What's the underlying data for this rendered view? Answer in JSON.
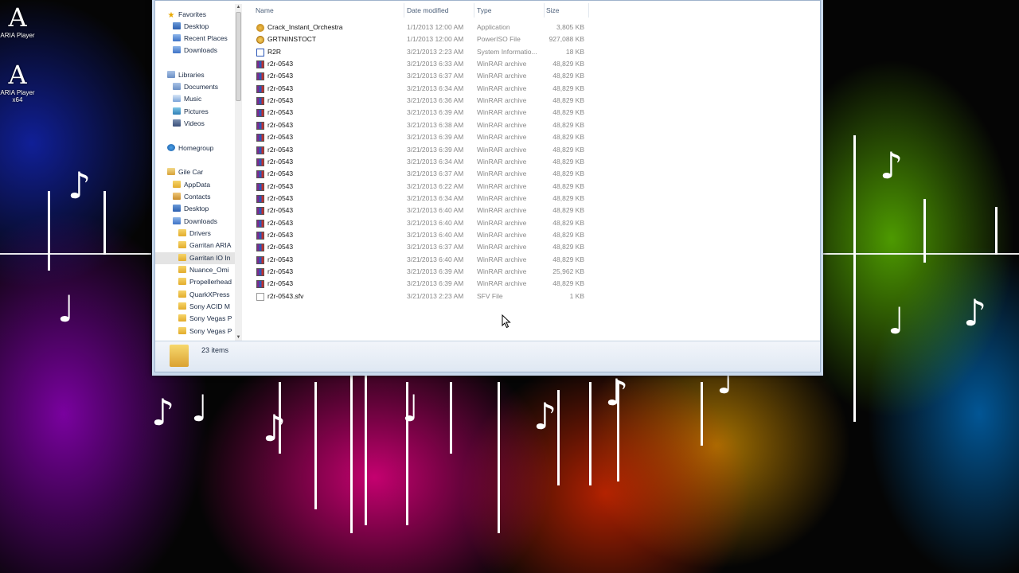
{
  "desktop": {
    "icons": [
      {
        "label": "ARIA Player",
        "glyph": "A"
      },
      {
        "label": "ARIA Player x64",
        "glyph": "A"
      }
    ],
    "deco_notes": [
      "♪",
      "♩",
      "♪",
      "♩",
      "♪",
      "♩",
      "♪"
    ]
  },
  "explorer": {
    "nav": {
      "favorites": "Favorites",
      "fav_items": [
        "Desktop",
        "Recent Places",
        "Downloads"
      ],
      "libraries": "Libraries",
      "lib_items": [
        "Documents",
        "Music",
        "Pictures",
        "Videos"
      ],
      "homegroup": "Homegroup",
      "user": "Gile Car",
      "user_items": [
        "AppData",
        "Contacts",
        "Desktop",
        "Downloads"
      ],
      "download_folders": [
        "Drivers",
        "Garritan ARIA",
        "Garritan IO In",
        "Nuance_Omi",
        "Propellerhead",
        "QuarkXPress",
        "Sony ACID M",
        "Sony Vegas P",
        "Sony Vegas P"
      ],
      "selected": "Garritan IO In"
    },
    "columns": {
      "name": "Name",
      "date": "Date modified",
      "type": "Type",
      "size": "Size"
    },
    "files": [
      {
        "icon": "app",
        "name": "Crack_Instant_Orchestra",
        "date": "1/1/2013 12:00 AM",
        "type": "Application",
        "size": "3,805 KB"
      },
      {
        "icon": "iso",
        "name": "GRTNINSTOCT",
        "date": "1/1/2013 12:00 AM",
        "type": "PowerISO File",
        "size": "927,088 KB"
      },
      {
        "icon": "info",
        "name": "R2R",
        "date": "3/21/2013 2:23 AM",
        "type": "System Informatio...",
        "size": "18 KB"
      },
      {
        "icon": "rar",
        "name": "r2r-0543",
        "date": "3/21/2013 6:33 AM",
        "type": "WinRAR archive",
        "size": "48,829 KB"
      },
      {
        "icon": "rar",
        "name": "r2r-0543",
        "date": "3/21/2013 6:37 AM",
        "type": "WinRAR archive",
        "size": "48,829 KB"
      },
      {
        "icon": "rar",
        "name": "r2r-0543",
        "date": "3/21/2013 6:34 AM",
        "type": "WinRAR archive",
        "size": "48,829 KB"
      },
      {
        "icon": "rar",
        "name": "r2r-0543",
        "date": "3/21/2013 6:36 AM",
        "type": "WinRAR archive",
        "size": "48,829 KB"
      },
      {
        "icon": "rar",
        "name": "r2r-0543",
        "date": "3/21/2013 6:39 AM",
        "type": "WinRAR archive",
        "size": "48,829 KB"
      },
      {
        "icon": "rar",
        "name": "r2r-0543",
        "date": "3/21/2013 6:38 AM",
        "type": "WinRAR archive",
        "size": "48,829 KB"
      },
      {
        "icon": "rar",
        "name": "r2r-0543",
        "date": "3/21/2013 6:39 AM",
        "type": "WinRAR archive",
        "size": "48,829 KB"
      },
      {
        "icon": "rar",
        "name": "r2r-0543",
        "date": "3/21/2013 6:39 AM",
        "type": "WinRAR archive",
        "size": "48,829 KB"
      },
      {
        "icon": "rar",
        "name": "r2r-0543",
        "date": "3/21/2013 6:34 AM",
        "type": "WinRAR archive",
        "size": "48,829 KB"
      },
      {
        "icon": "rar",
        "name": "r2r-0543",
        "date": "3/21/2013 6:37 AM",
        "type": "WinRAR archive",
        "size": "48,829 KB"
      },
      {
        "icon": "rar",
        "name": "r2r-0543",
        "date": "3/21/2013 6:22 AM",
        "type": "WinRAR archive",
        "size": "48,829 KB"
      },
      {
        "icon": "rar",
        "name": "r2r-0543",
        "date": "3/21/2013 6:34 AM",
        "type": "WinRAR archive",
        "size": "48,829 KB"
      },
      {
        "icon": "rar",
        "name": "r2r-0543",
        "date": "3/21/2013 6:40 AM",
        "type": "WinRAR archive",
        "size": "48,829 KB"
      },
      {
        "icon": "rar",
        "name": "r2r-0543",
        "date": "3/21/2013 6:40 AM",
        "type": "WinRAR archive",
        "size": "48,829 KB"
      },
      {
        "icon": "rar",
        "name": "r2r-0543",
        "date": "3/21/2013 6:40 AM",
        "type": "WinRAR archive",
        "size": "48,829 KB"
      },
      {
        "icon": "rar",
        "name": "r2r-0543",
        "date": "3/21/2013 6:37 AM",
        "type": "WinRAR archive",
        "size": "48,829 KB"
      },
      {
        "icon": "rar",
        "name": "r2r-0543",
        "date": "3/21/2013 6:40 AM",
        "type": "WinRAR archive",
        "size": "48,829 KB"
      },
      {
        "icon": "rar",
        "name": "r2r-0543",
        "date": "3/21/2013 6:39 AM",
        "type": "WinRAR archive",
        "size": "25,962 KB"
      },
      {
        "icon": "rar",
        "name": "r2r-0543",
        "date": "3/21/2013 6:39 AM",
        "type": "WinRAR archive",
        "size": "48,829 KB"
      },
      {
        "icon": "file",
        "name": "r2r-0543.sfv",
        "date": "3/21/2013 2:23 AM",
        "type": "SFV File",
        "size": "1 KB"
      }
    ],
    "status": {
      "item_count": "23 items"
    }
  }
}
